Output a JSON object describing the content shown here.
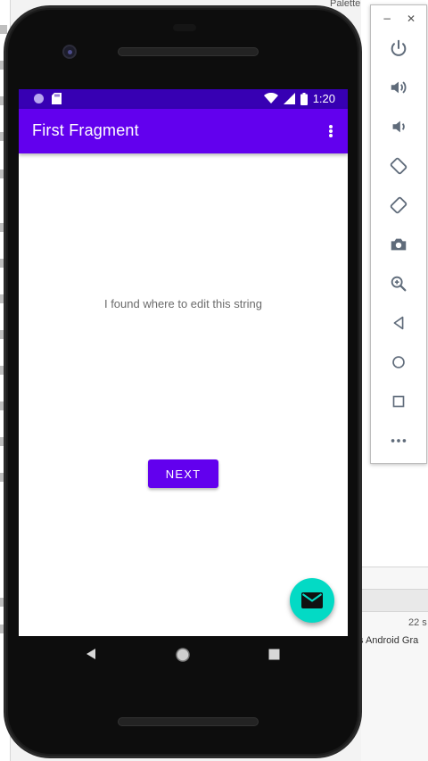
{
  "app": {
    "title": "First Fragment",
    "body_text": "I found where to edit this string",
    "next_label": "NEXT"
  },
  "statusbar": {
    "time": "1:20"
  },
  "ide": {
    "palette_label": "Palette",
    "bottom_text": "s Android Gra",
    "bottom_right_text": "22 s"
  },
  "emulator_toolbar": {
    "minimize": "−",
    "close": "✕",
    "buttons": [
      "power-icon",
      "volume-up-icon",
      "volume-down-icon",
      "rotate-left-icon",
      "rotate-right-icon",
      "camera-icon",
      "zoom-icon",
      "back-icon",
      "home-icon",
      "overview-icon",
      "more-icon"
    ]
  },
  "colors": {
    "primary": "#6200ee",
    "primary_dark": "#3700b3",
    "accent": "#03dac5"
  }
}
